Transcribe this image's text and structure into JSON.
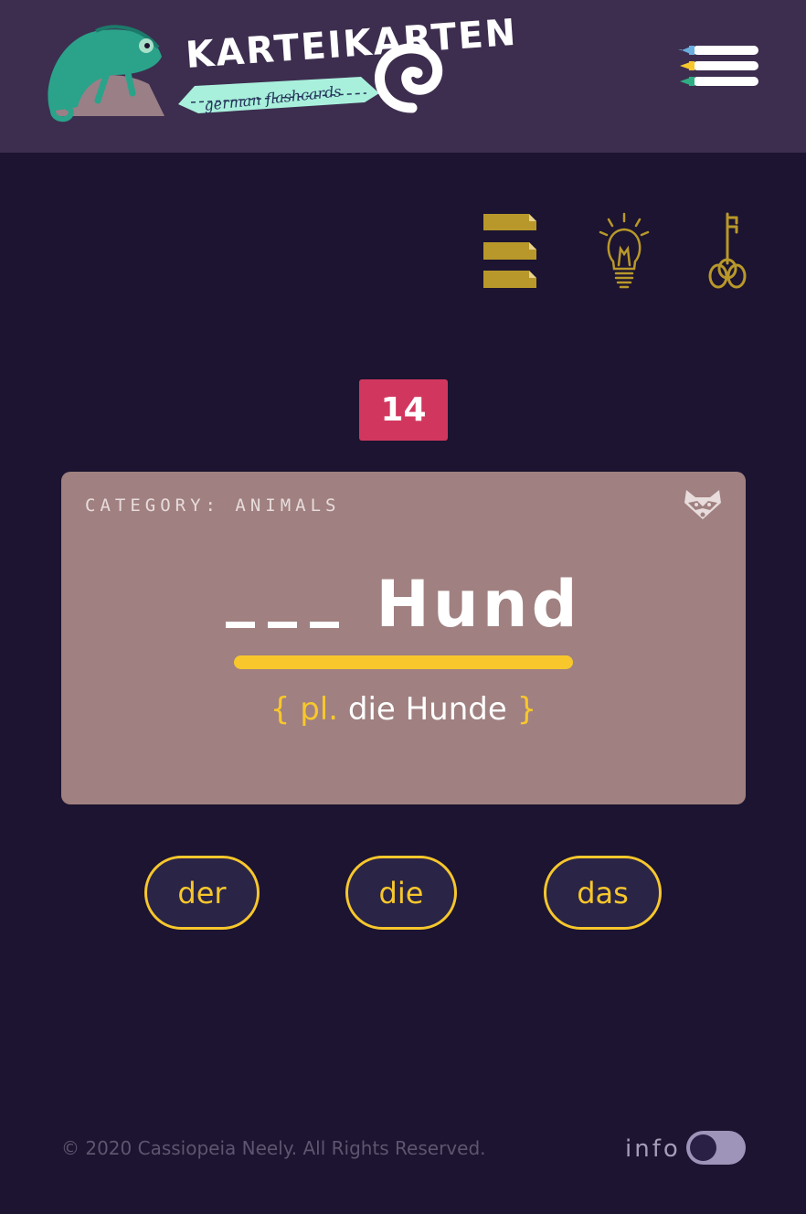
{
  "header": {
    "logo_title": "KARTEIKARTEN",
    "logo_subtitle": "german flashcards"
  },
  "colors": {
    "background": "#1c1430",
    "header": "#3d2e4f",
    "accent_yellow": "#f7c72c",
    "counter_red": "#d1375e",
    "card": "#a08080",
    "toolbar_gold": "#b8982a"
  },
  "toolbar": {
    "icons": [
      "cards-stack-icon",
      "lightbulb-icon",
      "key-icon"
    ]
  },
  "counter": {
    "value": "14"
  },
  "card": {
    "category": "CATEGORY: ANIMALS",
    "category_icon": "raccoon-icon",
    "noun": "Hund",
    "plural_open": "{",
    "plural_prefix": "pl.",
    "plural_text": "die Hunde",
    "plural_close": "}"
  },
  "articles": [
    "der",
    "die",
    "das"
  ],
  "footer": {
    "copyright": "© 2020 Cassiopeia Neely. All Rights Reserved.",
    "info_label": "info",
    "info_toggle_on": false
  }
}
